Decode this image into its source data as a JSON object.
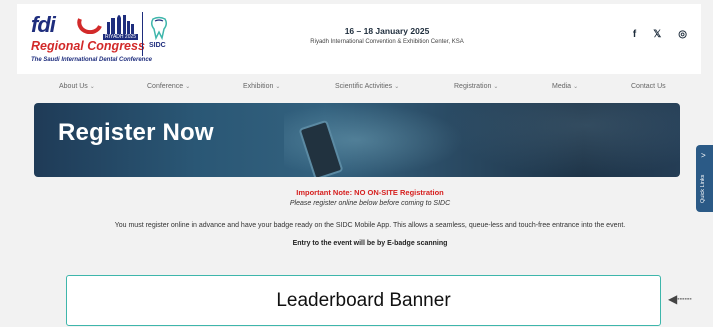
{
  "header": {
    "logo": {
      "brand": "fdi",
      "event_name": "Regional Congress",
      "year_badge": "RIYADH 2025",
      "tagline": "The Saudi International Dental Conference",
      "partner": "SIDC"
    },
    "event_date": "16 – 18 January 2025",
    "event_venue": "Riyadh International Convention & Exhibition Center, KSA",
    "social": [
      {
        "icon": "facebook-icon",
        "glyph": "f"
      },
      {
        "icon": "x-twitter-icon",
        "glyph": "𝕏"
      },
      {
        "icon": "instagram-icon",
        "glyph": "◎"
      }
    ]
  },
  "nav": {
    "items": [
      {
        "label": "About Us",
        "dropdown": true
      },
      {
        "label": "Conference",
        "dropdown": true
      },
      {
        "label": "Exhibition",
        "dropdown": true
      },
      {
        "label": "Scientific Activities",
        "dropdown": true
      },
      {
        "label": "Registration",
        "dropdown": true
      },
      {
        "label": "Media",
        "dropdown": true
      },
      {
        "label": "Contact Us",
        "dropdown": false
      }
    ]
  },
  "hero": {
    "title": "Register Now"
  },
  "quick_links": {
    "label": "Quick Links",
    "arrow": ">"
  },
  "content": {
    "important_note": "Important Note: NO ON-SITE Registration",
    "sub_note": "Please register online below before coming to SIDC",
    "paragraph": "You must register online in advance and have your badge ready on the SIDC Mobile App. This allows a seamless, queue-less and touch-free entrance into the event.",
    "entry": "Entry to the event will be by E-badge scanning"
  },
  "banner": {
    "label": "Leaderboard Banner"
  },
  "colors": {
    "brand_blue": "#1e2d7d",
    "brand_red": "#d22a2a",
    "note_red": "#d6201f",
    "banner_border": "#3eb6ab",
    "side_tab": "#2b5a86"
  }
}
